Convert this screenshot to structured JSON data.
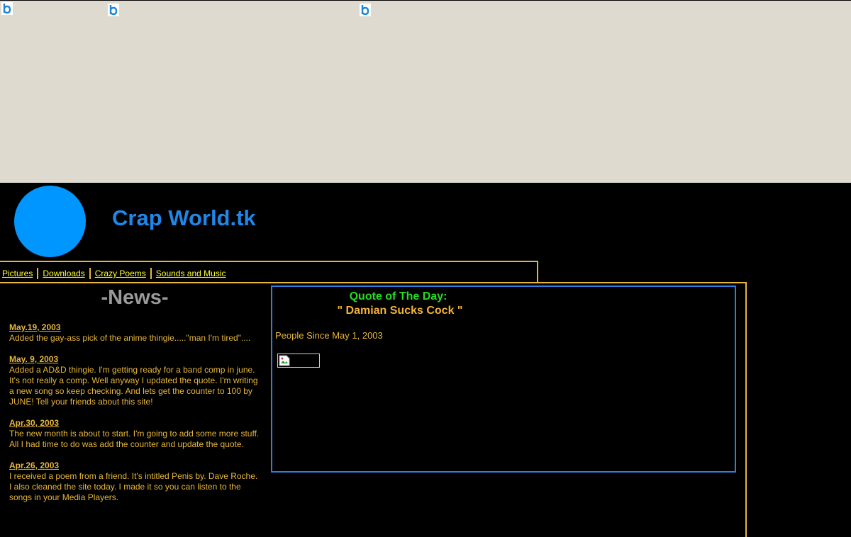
{
  "ad_banner": {
    "icons": [
      "ad-badge-icon",
      "ad-badge-icon",
      "ad-badge-icon"
    ],
    "background": "#dedacf"
  },
  "header": {
    "site_title": "Crap World.tk",
    "logo_color": "#0096ff"
  },
  "nav": {
    "items": [
      {
        "label": "Pictures"
      },
      {
        "label": "Downloads"
      },
      {
        "label": "Crazy Poems"
      },
      {
        "label": "Sounds and Music"
      }
    ]
  },
  "news": {
    "heading": "-News-",
    "items": [
      {
        "date": "May.19, 2003",
        "text": "Added the gay-ass pick of the anime thingie.....\"man I'm tired\"...."
      },
      {
        "date": "May. 9, 2003",
        "text": "Added a AD&D thingie. I'm getting ready for a band comp in june. It's not really a comp. Well anyway I updated the quote. I'm writing a new song so keep checking. And lets get the counter to 100 by JUNE! Tell your friends about this site!"
      },
      {
        "date": "Apr.30, 2003",
        "text": "The new month is about to start. I'm going to add some more stuff. All I had time to do was add the counter and update the quote."
      },
      {
        "date": "Apr.26, 2003",
        "text": "I received a poem from a friend. It's intitled Penis by. Dave Roche. I also cleaned the site today. I made it so you can listen to the songs in your Media Players."
      }
    ]
  },
  "quote": {
    "title": "Quote of The Day:",
    "text": "\" Damian Sucks Cock \""
  },
  "counter": {
    "label": "People Since May 1, 2003",
    "image_icon": "broken-image-icon"
  },
  "colors": {
    "accent": "#e8b63a",
    "link": "#ffff33",
    "title": "#1f87e8",
    "quote_title": "#22dd22",
    "box_border": "#2f7fe0"
  }
}
